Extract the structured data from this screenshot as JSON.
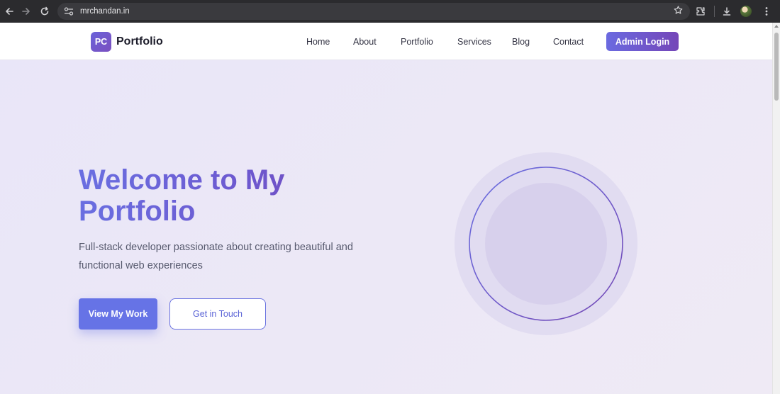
{
  "browser": {
    "url": "mrchandan.in",
    "icons": [
      "back-arrow-icon",
      "forward-arrow-icon",
      "reload-icon",
      "site-settings-icon",
      "bookmark-star-icon",
      "extensions-icon",
      "download-icon",
      "profile-avatar",
      "more-menu-icon"
    ]
  },
  "header": {
    "brand_badge": "PC",
    "brand_name": "Portfolio",
    "nav": [
      "Home",
      "About",
      "Portfolio",
      "Services",
      "Blog",
      "Contact"
    ],
    "admin_button": "Admin Login"
  },
  "hero": {
    "title": "Welcome to My Portfolio",
    "subtitle": "Full-stack developer passionate about creating beautiful and functional web experiences",
    "primary_button": "View My Work",
    "secondary_button": "Get in Touch"
  },
  "colors": {
    "accent": "#6673e6",
    "accent_purple": "#7446b8",
    "page_bg": "#ece8f6",
    "chrome_bg": "#2b2b2e"
  }
}
